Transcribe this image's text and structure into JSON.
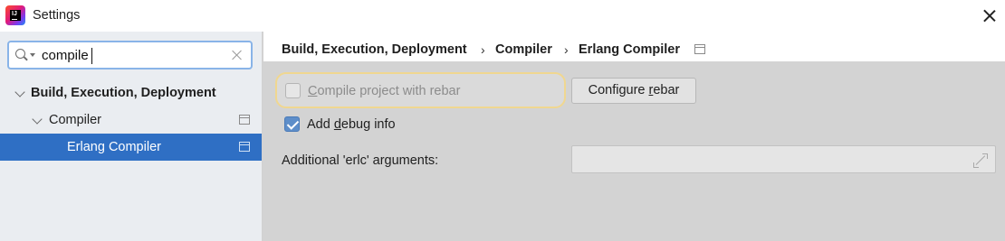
{
  "window": {
    "title": "Settings",
    "logo_text": "IJ"
  },
  "search": {
    "value": "compile",
    "placeholder": ""
  },
  "tree": {
    "items": [
      {
        "label": "Build, Execution, Deployment",
        "expanded": true,
        "bold": true
      },
      {
        "label": "Compiler",
        "expanded": true
      },
      {
        "label": "Erlang Compiler",
        "selected": true
      }
    ]
  },
  "breadcrumb": {
    "items": [
      "Build, Execution, Deployment",
      "Compiler",
      "Erlang Compiler"
    ],
    "separator": "›"
  },
  "settings": {
    "compile_with_rebar": {
      "label_mnemonic": "C",
      "label_rest": "ompile project with rebar",
      "checked": false,
      "enabled": false
    },
    "configure_rebar_button": {
      "label_before": "Configure ",
      "label_mnemonic": "r",
      "label_after": "ebar"
    },
    "add_debug_info": {
      "label_before": "Add ",
      "label_mnemonic": "d",
      "label_after": "ebug info",
      "checked": true
    },
    "erlc_arguments": {
      "label": "Additional 'erlc' arguments:",
      "value": ""
    }
  },
  "colors": {
    "selection": "#2f6fc4",
    "sidebar_bg": "#eaedf1",
    "content_bg": "#d3d3d3",
    "focus_ring": "#f0d790",
    "checkbox_checked": "#5e8ec9"
  }
}
